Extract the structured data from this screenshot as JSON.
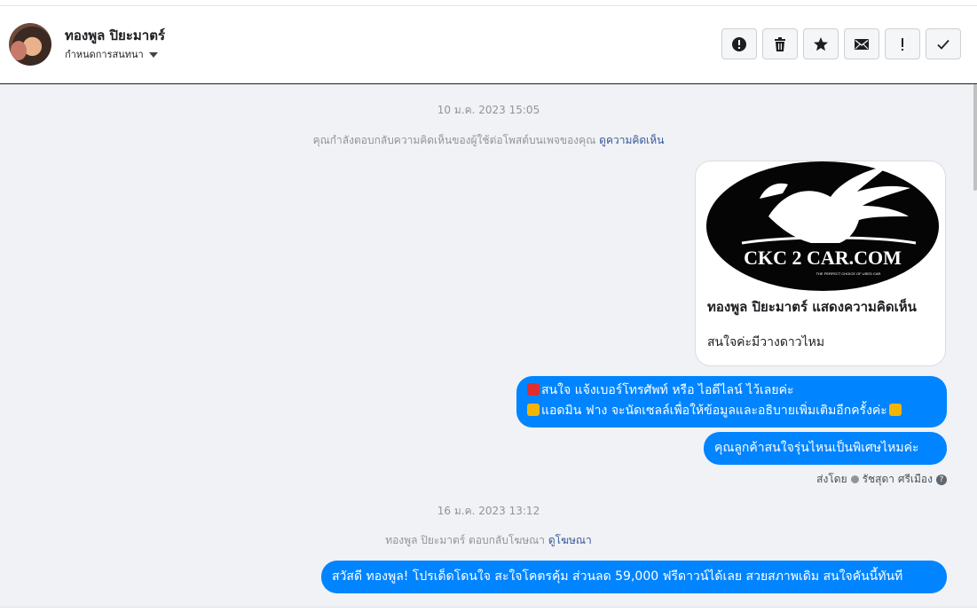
{
  "contact": {
    "name": "ทองพูล ปิยะมาตร์",
    "assign_label": "กำหนดการสนทนา"
  },
  "toolbar": {
    "buttons": [
      {
        "name": "report",
        "icon": "alert-circle-icon"
      },
      {
        "name": "delete",
        "icon": "trash-icon"
      },
      {
        "name": "star",
        "icon": "star-icon"
      },
      {
        "name": "mark-unread",
        "icon": "envelope-icon"
      },
      {
        "name": "important",
        "icon": "exclamation-icon"
      },
      {
        "name": "done",
        "icon": "check-icon"
      }
    ]
  },
  "thread": {
    "timestamp_1": "10 ม.ค. 2023 15:05",
    "system_1_text": "คุณกำลังตอบกลับความคิดเห็นของผู้ใช้ต่อโพสต์บนเพจของคุณ",
    "system_1_link": "ดูความคิดเห็น",
    "card": {
      "logo_text": "CKC 2 CAR.COM",
      "logo_tagline": "THE PERFECT CHOICE OF USED CAR",
      "title": "ทองพูล ปิยะมาตร์ แสดงความคิดเห็น",
      "body": "สนใจค่ะมีวางดาวไหม"
    },
    "msg_1_line_1": "สนใจ แจ้งเบอร์โทรศัพท์ หรือ ไอดีไลน์  ไว้เลยค่ะ",
    "msg_1_line_2": "แอดมิน ฟาง จะนัดเซลล์เพื่อให้ข้อมูลและอธิบายเพิ่มเติมอีกครั้งค่ะ",
    "msg_2": "คุณลูกค้าสนใจรุ่นไหนเป็นพิเศษไหมค่ะ",
    "sent_by_label": "ส่งโดย",
    "sent_by_name": "รัชสุดา ศรีเมือง",
    "timestamp_2": "16 ม.ค. 2023 13:12",
    "system_2_text": "ทองพูล ปิยะมาตร์ ตอบกลับโฆษณา",
    "system_2_link": "ดูโฆษณา",
    "msg_3": "สวัสดี ทองพูล! โปรเด็ดโดนใจ สะใจโคตรคุ้ม ส่วนลด 59,000 ฟรีดาวน์ได้เลย สวยสภาพเดิม สนใจคันนี้ทันที"
  },
  "colors": {
    "bubble": "#0084ff",
    "link": "#385898",
    "background": "#f0f2f5"
  }
}
